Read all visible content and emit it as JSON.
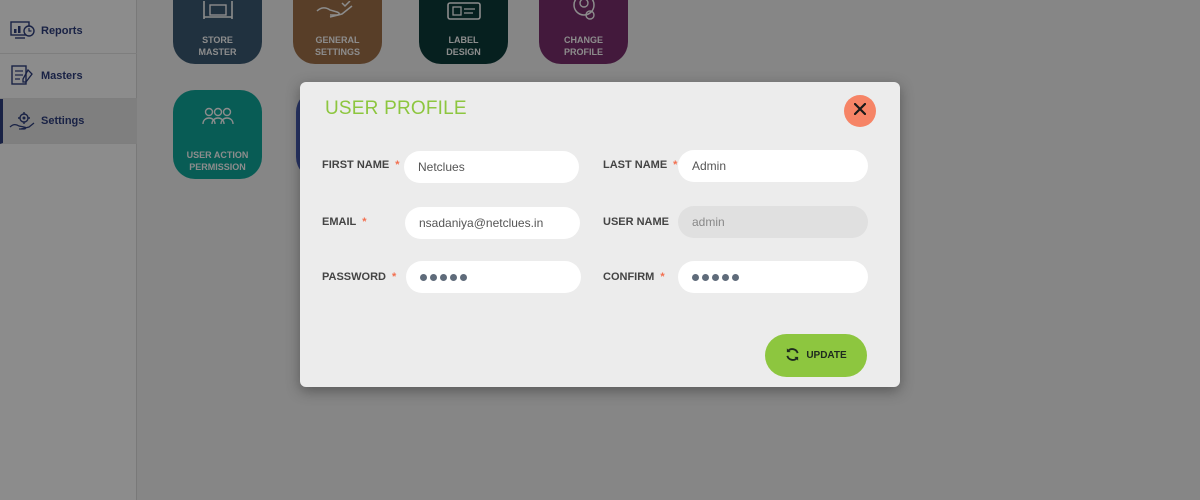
{
  "sidebar": {
    "items": [
      {
        "label": "Reports",
        "icon": "reports-icon"
      },
      {
        "label": "Masters",
        "icon": "masters-icon"
      },
      {
        "label": "Settings",
        "icon": "settings-icon",
        "active": true
      }
    ]
  },
  "tiles": [
    {
      "line1": "STORE",
      "line2": "MASTER",
      "color": "#3b5a73",
      "icon": "store-icon"
    },
    {
      "line1": "GENERAL",
      "line2": "SETTINGS",
      "color": "#a0714a",
      "icon": "hand-settings-icon"
    },
    {
      "line1": "LABEL",
      "line2": "DESIGN",
      "color": "#0b3b3a",
      "icon": "label-design-icon"
    },
    {
      "line1": "CHANGE",
      "line2": "PROFILE",
      "color": "#7a2f6e",
      "icon": "profile-icon"
    },
    {
      "line1": "USER ACTION",
      "line2": "PERMISSION",
      "color": "#10a89b",
      "icon": "users-icon"
    }
  ],
  "modal": {
    "title": "USER PROFILE",
    "fields": {
      "first_name": {
        "label": "FIRST NAME",
        "value": "Netclues"
      },
      "last_name": {
        "label": "LAST NAME",
        "value": "Admin"
      },
      "email": {
        "label": "EMAIL",
        "value": "nsadaniya@netclues.in"
      },
      "user_name": {
        "label": "USER NAME",
        "value": "admin"
      },
      "password": {
        "label": "PASSWORD"
      },
      "confirm": {
        "label": "CONFIRM"
      }
    },
    "required_mark": "*",
    "update_label": "UPDATE"
  },
  "colors": {
    "accent": "#8dc63f",
    "close": "#f68466",
    "sidebar_text": "#2e3e7e"
  }
}
